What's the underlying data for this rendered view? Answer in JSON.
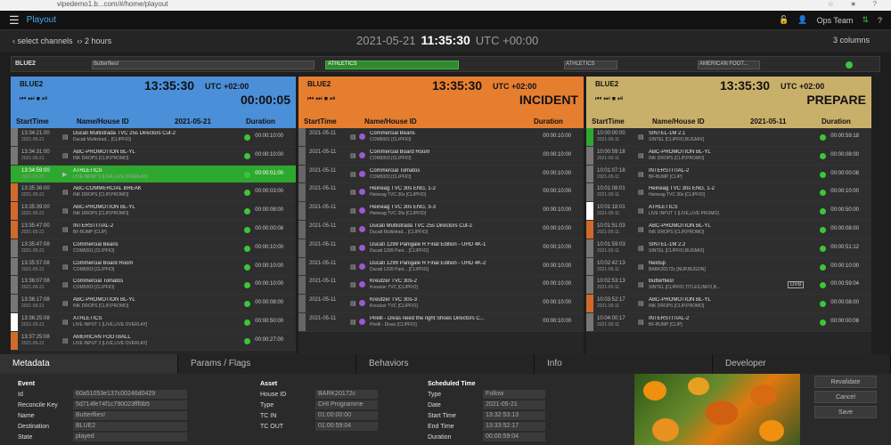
{
  "browser": {
    "url": "vipedemo1.b...com/#/home/playout"
  },
  "app": {
    "title": "Playout",
    "user": "Ops Team"
  },
  "controls": {
    "select_channels": "select channels",
    "duration": "2 hours",
    "date": "2021-05-21",
    "time": "11:35:30",
    "utc": "UTC +00:00",
    "columns": "3 columns"
  },
  "timeline": {
    "label": "BLUE2",
    "segments": [
      "Butterflies!",
      "ATHLETICS",
      "ATHLETICS",
      "AMERICAN FOOT..."
    ]
  },
  "columns": [
    {
      "channel": "BLUE2",
      "time": "13:35:30",
      "utc": "UTC +02:00",
      "state": "00:00:05",
      "color": "#4b8fd8",
      "h_start": "StartTime",
      "h_name": "Name/House ID",
      "h_date": "2021-05-21",
      "h_dur": "Duration",
      "rows": [
        {
          "t": "13:34:21:00",
          "d": "2021-05-21",
          "n": "Ducati Multistrada TVC 25s Directors Cut-2",
          "s": "Ducati Multistrad... [CLIPFIO]",
          "du": "00:00:10:00",
          "c": "#777"
        },
        {
          "t": "13:34:31:00",
          "d": "2021-05-21",
          "n": "ABC-PROMOTION BL-YL",
          "s": "INK DROPS [CLIP,PROMO]",
          "du": "00:00:10:00",
          "c": "#777"
        },
        {
          "t": "13:34:59:00",
          "d": "2021-05-21",
          "n": "ATHLETICS",
          "s": "LIVE INPUT 1 [LIVE,LIVE OVERLAY]",
          "du": "00:00:01:00",
          "c": "#2ea82e",
          "a": true
        },
        {
          "t": "13:35:36:00",
          "d": "2021-05-21",
          "n": "ABC-COMMERCIAL BREAK",
          "s": "INK DROPS [CLIP,PROMO]",
          "du": "00:00:03:00",
          "c": "#d06a2a"
        },
        {
          "t": "13:35:39:00",
          "d": "2021-05-21",
          "n": "ABC-PROMOTION BL-YL",
          "s": "INK DROPS [CLIP,PROMO]",
          "du": "00:00:08:00",
          "c": "#d06a2a"
        },
        {
          "t": "13:35:47:00",
          "d": "2021-05-21",
          "n": "INTERSTITIAL-2",
          "s": "BF-BUMP [CLIP]",
          "du": "00:00:00:08",
          "c": "#d06a2a"
        },
        {
          "t": "13:35:47:08",
          "d": "2021-05-21",
          "n": "Commercial Beans",
          "s": "COM5001 [CLIPFIO]",
          "du": "00:00:10:00",
          "c": "#777"
        },
        {
          "t": "13:35:57:08",
          "d": "2021-05-21",
          "n": "Commercial Board Room",
          "s": "COM5003 [CLIPFIO]",
          "du": "00:00:10:00",
          "c": "#777"
        },
        {
          "t": "13:36:07:08",
          "d": "2021-05-21",
          "n": "Commercial Tomatos",
          "s": "COM5003 [CLIPFIO]",
          "du": "00:00:10:00",
          "c": "#777"
        },
        {
          "t": "13:36:17:08",
          "d": "2021-05-21",
          "n": "ABC-PROMOTION BL-YL",
          "s": "INK DROPS [CLIP,PROMO]",
          "du": "00:00:08:00",
          "c": "#777"
        },
        {
          "t": "13:36:25:08",
          "d": "2021-05-21",
          "n": "ATHLETICS",
          "s": "LIVE INPUT 1 [LIVE,LIVE OVERLAY]",
          "du": "00:00:50:00",
          "c": "#fff"
        },
        {
          "t": "13:37:25:08",
          "d": "2021-05-21",
          "n": "AMERICAN FOOTBALL",
          "s": "LIVE INPUT 3 [LIVE,LIVE OVERLAY]",
          "du": "00:00:27:00",
          "c": "#d06a2a"
        }
      ]
    },
    {
      "channel": "BLUE2",
      "time": "13:35:30",
      "utc": "UTC +02:00",
      "state": "INCIDENT",
      "color": "#e67e30",
      "h_start": "StartTime",
      "h_name": "Name/House ID",
      "h_date": "",
      "h_dur": "Duration",
      "rows": [
        {
          "t": "2021-05-11",
          "n": "Commercial Beans",
          "s": "COM5001 [CLIPFIO]",
          "du": "00:00:10:00"
        },
        {
          "t": "2021-05-11",
          "n": "Commercial Board Room",
          "s": "COM5003 [CLIPFIO]",
          "du": "00:00:10:00"
        },
        {
          "t": "2021-05-11",
          "n": "Commercial Tomatos",
          "s": "COM5003 [CLIPFIO]",
          "du": "00:00:10:00"
        },
        {
          "t": "2021-05-11",
          "n": "Heineag TVC 30s ENG, 1-2",
          "s": "Heineag TVC 30s [CLIPFIO]",
          "du": "00:00:10:00"
        },
        {
          "t": "2021-05-11",
          "n": "Heineag TVC 30s ENG, 3-3",
          "s": "Heineag TVC 30s [CLIPFIO]",
          "du": "00:00:10:00"
        },
        {
          "t": "2021-05-11",
          "n": "Ducati Multistrada TVC 25s Directors Cut-2",
          "s": "Ducati Multistrad... [CLIPFIO]",
          "du": "00:00:10:00"
        },
        {
          "t": "2021-05-11",
          "n": "Ducati 1299 Panigale R Final Edition - UHD 4K-1",
          "s": "Ducati 1299 Pani... [CLIPFIO]",
          "du": "00:00:10:00"
        },
        {
          "t": "2021-05-11",
          "n": "Ducati 1299 Panigale R Final Edition - UHD 4K-2",
          "s": "Ducati 1299 Pani... [CLIPFIO]",
          "du": "00:00:10:00"
        },
        {
          "t": "2021-05-11",
          "n": "Kreutzer TVC 30s-2",
          "s": "Kreutzer TVC [CLIPFIO]",
          "du": "00:00:10:00"
        },
        {
          "t": "2021-05-11",
          "n": "Kreutzer TVC 30s-3",
          "s": "Kreutzer TVC [CLIPFIO]",
          "du": "00:00:10:00"
        },
        {
          "t": "2021-05-11",
          "n": "Pirelli - Divas need the right Shoes Directors C...",
          "s": "Pirelli - Divas [CLIPFIO]",
          "du": "00:00:10:00"
        }
      ]
    },
    {
      "channel": "BLUE2",
      "time": "13:35:30",
      "utc": "UTC +02:00",
      "state": "PREPARE",
      "color": "#c9b06a",
      "h_start": "StartTime",
      "h_name": "Name/House ID",
      "h_date": "2021-05-11",
      "h_dur": "Duration",
      "rows": [
        {
          "t": "10:00:00:00",
          "d": "2021-05-11",
          "n": "SINTEL-1M 2.1",
          "s": "SINTEL [CLIPFIO,BUGMIX]",
          "du": "00:00:59:18",
          "c": "#2ea82e"
        },
        {
          "t": "10:00:59:18",
          "d": "2021-05-11",
          "n": "ABC-PROMOTION BL-YL",
          "s": "INK DROPS [CLIP,PROMO]",
          "du": "00:00:08:00",
          "c": "#777"
        },
        {
          "t": "10:01:07:18",
          "d": "2021-05-11",
          "n": "INTERSTITIAL-2",
          "s": "BF-BUMP [CLIP]",
          "du": "00:00:00:08",
          "c": "#777"
        },
        {
          "t": "10:01:08:01",
          "d": "2021-05-11",
          "n": "Heineag TVC 30s ENG, 1-2",
          "s": "Heineag TVC 30s [CLIPFIO]",
          "du": "00:00:10:00",
          "c": "#777"
        },
        {
          "t": "10:01:18:01",
          "d": "2021-05-11",
          "n": "ATHLETICS",
          "s": "LIVE INPUT 1 [LIVE,LIVE PROMO]",
          "du": "00:00:50:00",
          "c": "#fff"
        },
        {
          "t": "10:01:51:03",
          "d": "2021-05-11",
          "n": "ABC-PROMOTION BL-YL",
          "s": "INK DROPS [CLIP,PROMO]",
          "du": "00:00:08:00",
          "c": "#d06a2a"
        },
        {
          "t": "10:01:59:03",
          "d": "2021-05-11",
          "n": "SINTEL-1M 2.2",
          "s": "SINTEL [CLIPFIO,BUGMIX]",
          "du": "00:00:51:12",
          "c": "#777"
        },
        {
          "t": "10:02:42:13",
          "d": "2021-05-11",
          "n": "Nextup",
          "s": "BARK20172c [NUP,BUGON]",
          "du": "00:00:10:00",
          "c": "#777"
        },
        {
          "t": "10:02:53:13",
          "d": "2021-05-11",
          "n": "Butterflies!",
          "s": "SINTEL [CLIPFIO,TITLES,INFO,B...",
          "du": "00:00:59:04",
          "c": "#777",
          "badge": "DVB"
        },
        {
          "t": "10:03:52:17",
          "d": "2021-05-11",
          "n": "ABC-PROMOTION BL-YL",
          "s": "INK DROPS [CLIP,PROMO]",
          "du": "00:00:08:00",
          "c": "#d06a2a"
        },
        {
          "t": "10:04:00:17",
          "d": "2021-05-11",
          "n": "INTERSTITIAL-2",
          "s": "BF-BUMP [CLIP]",
          "du": "00:00:00:08",
          "c": "#777"
        }
      ]
    }
  ],
  "tabs": [
    "Metadata",
    "Params / Flags",
    "Behaviors",
    "Info",
    "Developer"
  ],
  "metadata": {
    "event": {
      "title": "Event",
      "rows": [
        [
          "Id",
          "60a51053e137c00246d0429"
        ],
        [
          "Reconcile Key",
          "5d714fe74f1c790023fff0b5"
        ],
        [
          "Name",
          "Butterflies!"
        ],
        [
          "Destination",
          "BLUE2"
        ],
        [
          "State",
          "played"
        ]
      ]
    },
    "asset": {
      "title": "Asset",
      "rows": [
        [
          "House ID",
          "BARK20172c"
        ],
        [
          "Type",
          "CHI Programme"
        ],
        [
          "TC IN",
          "01:00:00:00"
        ],
        [
          "TC OUT",
          "01:00:59:04"
        ]
      ]
    },
    "scheduled": {
      "title": "Scheduled Time",
      "rows": [
        [
          "Type",
          "Follow"
        ],
        [
          "Date",
          "2021-05-21"
        ],
        [
          "Start Time",
          "13:32:53:13"
        ],
        [
          "End Time",
          "13:33:52:17"
        ],
        [
          "Duration",
          "00:00:59:04"
        ]
      ]
    }
  },
  "buttons": {
    "revalidate": "Revalidate",
    "cancel": "Cancel",
    "save": "Save"
  }
}
